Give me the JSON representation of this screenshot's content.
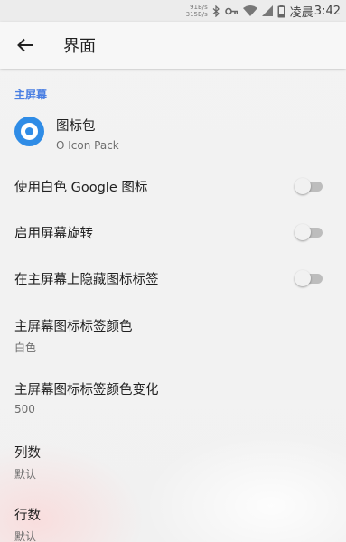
{
  "status_bar": {
    "net_speed_up": "91B/s",
    "net_speed_down": "315B/s",
    "carrier": "凌晨",
    "time": "3:42",
    "icons": [
      "bluetooth-icon",
      "key-icon",
      "wifi-icon",
      "signal-icon",
      "battery-icon"
    ],
    "battery_level": "11"
  },
  "app_bar": {
    "back_icon": "arrow-back-icon",
    "title": "界面"
  },
  "section": {
    "header": "主屏幕"
  },
  "icon_pack": {
    "title": "图标包",
    "summary": "O Icon Pack"
  },
  "toggles": [
    {
      "label": "使用白色 Google 图标",
      "on": false
    },
    {
      "label": "启用屏幕旋转",
      "on": false
    },
    {
      "label": "在主屏幕上隐藏图标标签",
      "on": false
    }
  ],
  "prefs": [
    {
      "title": "主屏幕图标标签颜色",
      "summary": "白色"
    },
    {
      "title": "主屏幕图标标签颜色变化",
      "summary": "500"
    },
    {
      "title": "列数",
      "summary": "默认"
    },
    {
      "title": "行数",
      "summary": "默认"
    }
  ],
  "colors": {
    "accent": "#4a7fe3",
    "icon_pack": "#2f8ce6",
    "switch_track_off": "#bdbdbd"
  }
}
